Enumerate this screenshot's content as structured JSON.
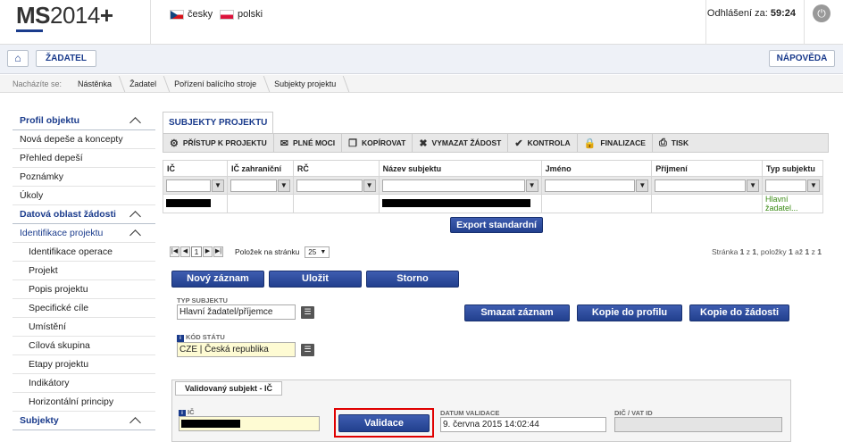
{
  "header": {
    "logo": "MS2014+",
    "logo_bold": "MS",
    "logo_thin": "2014",
    "logo_plus": "+",
    "lang_cz": "česky",
    "lang_pl": "polski",
    "logout_label": "Odhlášení za:",
    "logout_time": "59:24"
  },
  "nav": {
    "zadatel": "ŽADATEL",
    "napoveda": "NÁPOVĚDA"
  },
  "breadcrumb": {
    "label": "Nacházíte se:",
    "items": [
      "Nástěnka",
      "Žadatel",
      "Pořízení balícího stroje",
      "Subjekty projektu"
    ]
  },
  "sidebar": {
    "items": [
      {
        "label": "Profil objektu",
        "kind": "head"
      },
      {
        "label": "Nová depeše a koncepty",
        "kind": "item"
      },
      {
        "label": "Přehled depeší",
        "kind": "item"
      },
      {
        "label": "Poznámky",
        "kind": "item"
      },
      {
        "label": "Úkoly",
        "kind": "item"
      },
      {
        "label": "Datová oblast žádosti",
        "kind": "head"
      },
      {
        "label": "Identifikace projektu",
        "kind": "subhead"
      },
      {
        "label": "Identifikace operace",
        "kind": "sub"
      },
      {
        "label": "Projekt",
        "kind": "sub"
      },
      {
        "label": "Popis projektu",
        "kind": "sub"
      },
      {
        "label": "Specifické cíle",
        "kind": "sub"
      },
      {
        "label": "Umístění",
        "kind": "sub"
      },
      {
        "label": "Cílová skupina",
        "kind": "sub"
      },
      {
        "label": "Etapy projektu",
        "kind": "sub"
      },
      {
        "label": "Indikátory",
        "kind": "sub"
      },
      {
        "label": "Horizontální principy",
        "kind": "sub"
      },
      {
        "label": "Subjekty",
        "kind": "head"
      }
    ]
  },
  "main": {
    "tab_title": "SUBJEKTY PROJEKTU",
    "toolbar": {
      "pristup": "PŘÍSTUP K PROJEKTU",
      "plne_moci": "PLNÉ MOCI",
      "kopirovat": "KOPÍROVAT",
      "vymazat": "VYMAZAT ŽÁDOST",
      "kontrola": "KONTROLA",
      "finalizace": "FINALIZACE",
      "tisk": "TISK"
    },
    "table": {
      "columns": [
        "IČ",
        "IČ zahraniční",
        "RČ",
        "Název subjektu",
        "Jméno",
        "Příjmení",
        "Typ subjektu"
      ],
      "row_typ": "Hlavní žadatel..."
    },
    "export_btn": "Export standardní",
    "pager": {
      "page": "1",
      "per_page_label": "Položek na stránku",
      "per_page": "25",
      "summary_prefix": "Stránka",
      "page_num": "1",
      "of": "z",
      "page_total": "1",
      "items": ", položky",
      "item_from": "1",
      "to": "až",
      "item_to": "1",
      "items_of": "z",
      "item_total": "1"
    },
    "buttons": {
      "novy": "Nový záznam",
      "ulozit": "Uložit",
      "storno": "Storno",
      "smazat": "Smazat záznam",
      "kopie_profil": "Kopie do profilu",
      "kopie_zadost": "Kopie do žádosti",
      "validace": "Validace"
    },
    "form": {
      "typ_label": "TYP SUBJEKTU",
      "typ_value": "Hlavní žadatel/příjemce",
      "stat_label": "KÓD STÁTU",
      "stat_value": "CZE | Česká republika",
      "subtab": "Validovaný subjekt - IČ",
      "ic_label": "IČ",
      "datum_label": "DATUM VALIDACE",
      "datum_value": "9. června 2015 14:02:44",
      "dic_label": "DIČ / VAT ID"
    }
  },
  "colors": {
    "brand_blue": "#1a3b8c",
    "green_text": "#3c8c17",
    "highlight_red": "#e00000"
  }
}
